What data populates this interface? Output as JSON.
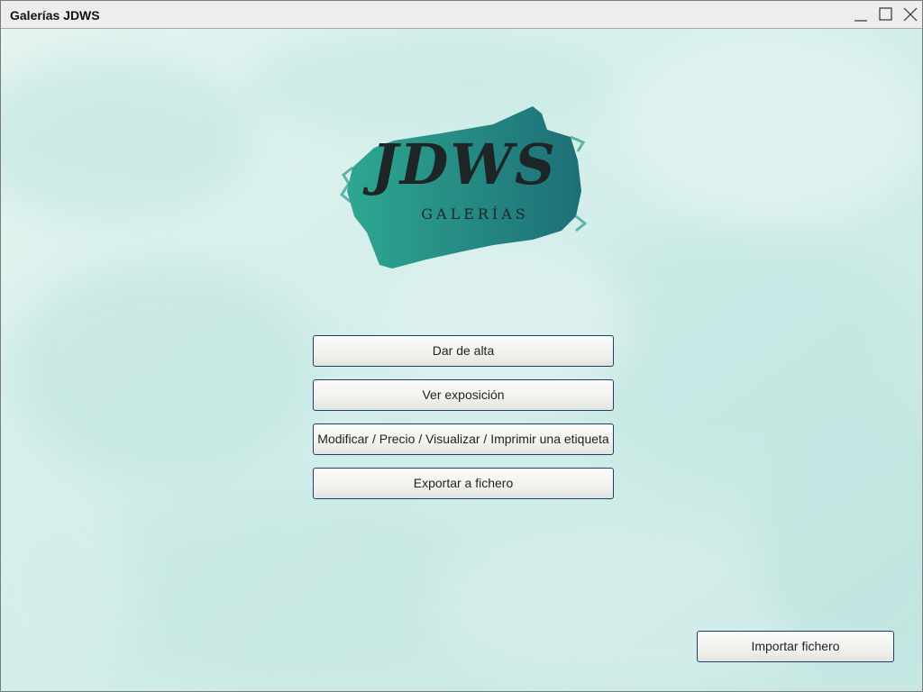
{
  "window": {
    "title": "Galerías JDWS",
    "controls": [
      {
        "name": "minimize-icon"
      },
      {
        "name": "maximize-icon"
      },
      {
        "name": "close-icon"
      }
    ]
  },
  "logo": {
    "main_text": "JDWS",
    "sub_text": "GALERÍAS",
    "colors": {
      "brush_left": "#27a08f",
      "brush_right": "#1d7276",
      "text": "#1d2526"
    }
  },
  "menu": {
    "buttons": [
      {
        "label": "Dar de alta"
      },
      {
        "label": "Ver exposición"
      },
      {
        "label": "Modificar / Precio / Visualizar / Imprimir una etiqueta"
      },
      {
        "label": "Exportar a fichero"
      }
    ]
  },
  "footer": {
    "import_label": "Importar fichero"
  },
  "theme": {
    "background": "#d9efec",
    "button_border": "#1e3f74"
  }
}
